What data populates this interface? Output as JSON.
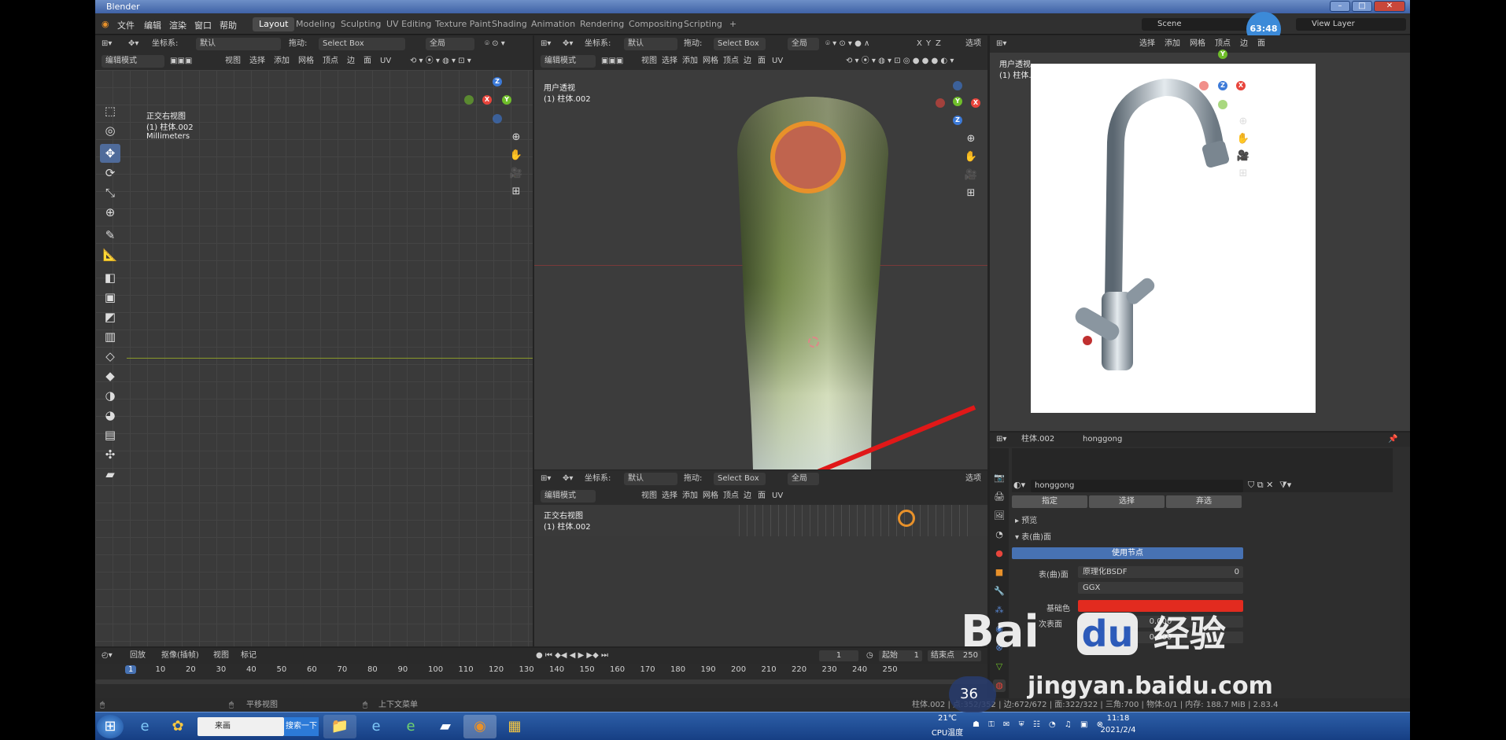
{
  "window": {
    "title": "Blender",
    "clock_badge": "63:48"
  },
  "menu": [
    "文件",
    "编辑",
    "渲染",
    "窗口",
    "帮助"
  ],
  "workspaces": [
    "Layout",
    "Modeling",
    "Sculpting",
    "UV Editing",
    "Texture Paint",
    "Shading",
    "Animation",
    "Rendering",
    "Compositing",
    "Scripting",
    "+"
  ],
  "scene": {
    "name": "Scene",
    "view_layer": "View Layer"
  },
  "left_view": {
    "header": {
      "coord_label": "坐标系:",
      "coord_value": "默认",
      "drag_label": "拖动:",
      "drag_value": "Select Box",
      "pivot": "全局"
    },
    "header2": {
      "mode": "编辑模式",
      "menus": [
        "视图",
        "选择",
        "添加",
        "网格",
        "顶点",
        "边",
        "面",
        "UV"
      ]
    },
    "overlay": {
      "view_name": "正交右视图",
      "object": "(1) 柱体.002",
      "units": "Millimeters"
    }
  },
  "center_view": {
    "header": {
      "coord_label": "坐标系:",
      "coord_value": "默认",
      "drag_label": "拖动:",
      "drag_value": "Select Box",
      "pivot": "全局",
      "xyz": [
        "X",
        "Y",
        "Z"
      ],
      "options": "选项"
    },
    "header2": {
      "mode": "编辑模式",
      "menus": [
        "视图",
        "选择",
        "添加",
        "网格",
        "顶点",
        "边",
        "面",
        "UV"
      ]
    },
    "overlay": {
      "view_name": "用户透视",
      "object": "(1) 柱体.002"
    }
  },
  "bottom_view": {
    "header": {
      "coord_label": "坐标系:",
      "coord_value": "默认",
      "drag_label": "拖动:",
      "drag_value": "Select Box",
      "pivot": "全局",
      "options": "选项"
    },
    "header2": {
      "mode": "编辑模式",
      "menus": [
        "视图",
        "选择",
        "添加",
        "网格",
        "顶点",
        "边",
        "面",
        "UV"
      ]
    },
    "overlay": {
      "view_name": "正交右视图",
      "object": "(1) 柱体.002"
    }
  },
  "right_view": {
    "header": {
      "menus": [
        "选择",
        "添加",
        "网格",
        "顶点",
        "边",
        "面"
      ]
    },
    "overlay": {
      "view_name": "用户透视",
      "object": "(1) 柱体.002"
    }
  },
  "properties": {
    "object": "柱体.002",
    "material": "honggong",
    "slot_material": "honggong",
    "buttons": [
      "指定",
      "选择",
      "弃选"
    ],
    "sections": {
      "preview": "预览",
      "surface": "表(曲)面"
    },
    "use_nodes": "使用节点",
    "surface_label": "表(曲)面",
    "surface_value": "原理化BSDF",
    "distribution": "GGX",
    "subsurface_label": "次表面",
    "subsurface_value": "0.000",
    "base_color_label": "基础色",
    "extra_value": "0.000",
    "zero": "0"
  },
  "timeline": {
    "menus": [
      "回放",
      "抠像(插帧)",
      "视图",
      "标记"
    ],
    "current_frame": "1",
    "start_label": "起始",
    "start": "1",
    "end_label": "结束点",
    "end": "250",
    "ticks": [
      "1",
      "10",
      "20",
      "30",
      "40",
      "50",
      "60",
      "70",
      "80",
      "90",
      "100",
      "110",
      "120",
      "130",
      "140",
      "150",
      "160",
      "170",
      "180",
      "190",
      "200",
      "210",
      "220",
      "230",
      "240",
      "250"
    ]
  },
  "statusbar": {
    "pan": "平移视图",
    "context_menu": "上下文菜单",
    "stats": "柱体.002 | 点:352/352 | 边:672/672 | 面:322/322 | 三角:700 | 物体:0/1 | 内存: 188.7 MiB | 2.83.4"
  },
  "taskbar": {
    "ie_tab": "来画",
    "search_btn": "搜索一下",
    "temp": "21℃",
    "cpu": "CPU温度",
    "time": "11:18",
    "date": "2021/2/4"
  },
  "watermark": {
    "brand": "Bai",
    "brand2": "du",
    "cn": "经验",
    "url": "jingyan.baidu.com",
    "corner": "36"
  },
  "colors": {
    "accent": "#4f6b9a",
    "selection": "#e8912a",
    "arrow": "#e01818",
    "axis_x": "#e8453c",
    "axis_y": "#6fbe2a",
    "axis_z": "#3c7ad8"
  }
}
